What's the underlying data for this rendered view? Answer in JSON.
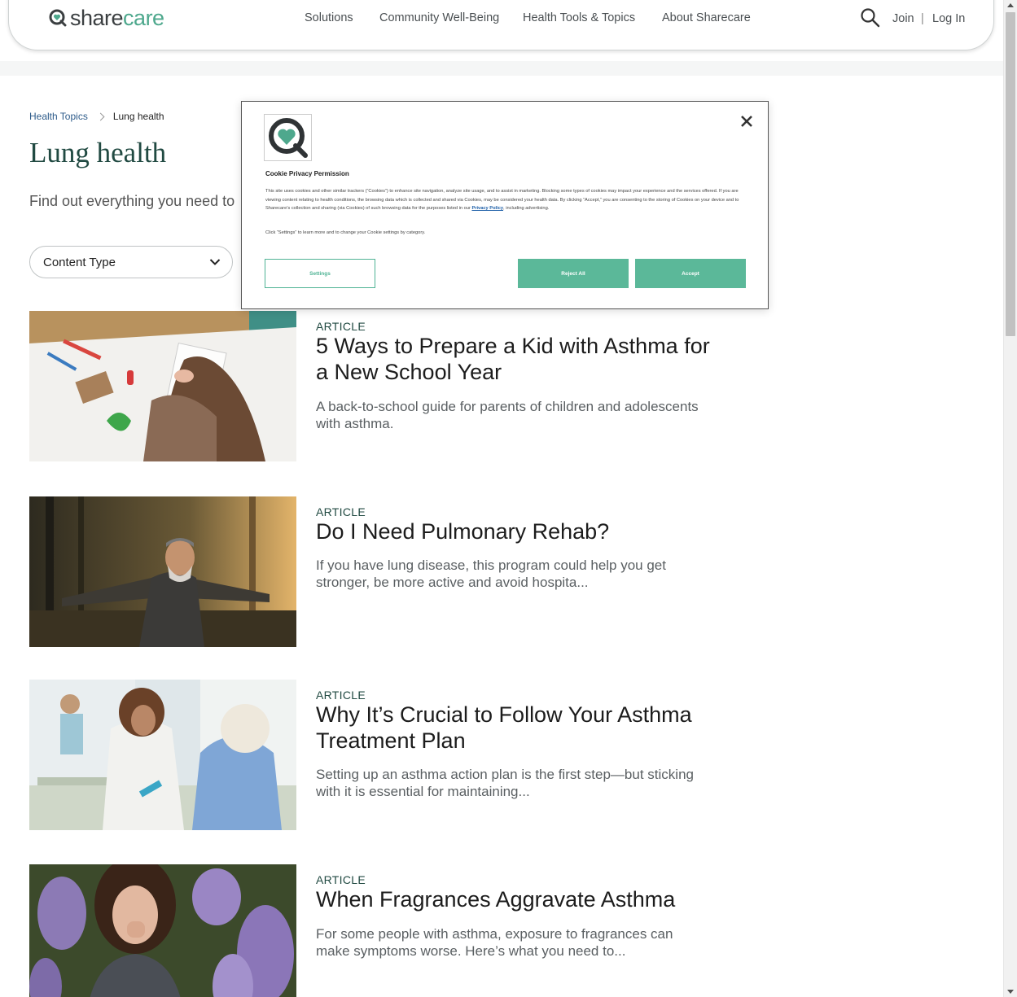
{
  "header": {
    "logo": {
      "share": "share",
      "care": "care"
    },
    "nav": [
      {
        "label": "Solutions"
      },
      {
        "label": "Community Well-Being"
      },
      {
        "label": "Health Tools & Topics"
      },
      {
        "label": "About Sharecare"
      }
    ],
    "join_label": "Join",
    "separator": "|",
    "login_label": "Log In"
  },
  "breadcrumb": {
    "parent": "Health Topics",
    "current": "Lung health"
  },
  "page": {
    "title": "Lung health",
    "intro": "Find out everything you need to k"
  },
  "filter": {
    "label": "Content Type"
  },
  "articles": [
    {
      "type": "ARTICLE",
      "title": "5 Ways to Prepare a Kid with Asthma for a New School Year",
      "description": "A back-to-school guide for parents of children and adolescents with asthma."
    },
    {
      "type": "ARTICLE",
      "title": "Do I Need Pulmonary Rehab?",
      "description": "If you have lung disease, this program could help you get stronger, be more active and avoid hospita..."
    },
    {
      "type": "ARTICLE",
      "title": "Why It’s Crucial to Follow Your Asthma Treatment Plan",
      "description": "Setting up an asthma action plan is the first step—but sticking with it is essential for maintaining..."
    },
    {
      "type": "ARTICLE",
      "title": "When Fragrances Aggravate Asthma",
      "description": "For some people with asthma, exposure to fragrances can make symptoms worse. Here’s what you need to..."
    }
  ],
  "cookie": {
    "title": "Cookie Privacy Permission",
    "body_before": "This site uses cookies and other similar trackers (“Cookies”) to enhance site navigation, analyze site usage, and to assist in marketing. Blocking some types of cookies may impact your experience and the services offered. If you are viewing content relating to health conditions, the browsing data which is collected and shared via Cookies, may be considered your health data. By clicking “Accept,” you are consenting to the storing of Cookies on your device and to Sharecare’s collection and sharing (via Cookies) of such browsing data for the purposes listed in our ",
    "privacy_link": "Privacy Policy",
    "body_after": ", including advertising.",
    "note": "Click “Settings” to learn more and to change your Cookie settings by category.",
    "settings_label": "Settings",
    "reject_label": "Reject All",
    "accept_label": "Accept"
  },
  "colors": {
    "brand_green": "#4ea88d",
    "button_green": "#5bb899",
    "title_green": "#214a42",
    "link_blue": "#2d5b8a"
  }
}
